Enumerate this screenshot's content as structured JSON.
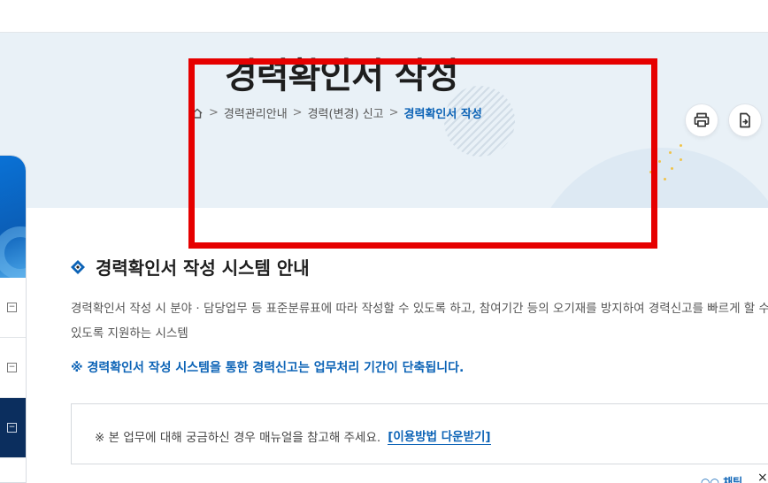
{
  "hero": {
    "title": "경력확인서 작성"
  },
  "breadcrumb": {
    "home_icon": "home-icon",
    "items": [
      "경력관리안내",
      "경력(변경) 신고",
      "경력확인서 작성"
    ],
    "separator": ">"
  },
  "tools": {
    "print_icon": "print-icon",
    "share_icon": "document-export-icon"
  },
  "section": {
    "title": "경력확인서 작성 시스템 안내",
    "desc_line1": "경력확인서 작성 시 분야 · 담당업무 등 표준분류표에 따라 작성할 수 있도록 하고, 참여기간 등의 오기재를 방지하여 경력신고를 빠르게 할 수",
    "desc_line2": "있도록 지원하는 시스템",
    "notice": "※ 경력확인서 작성 시스템을 통한 경력신고는 업무처리 기간이 단축됩니다."
  },
  "info_box": {
    "text": "※ 본 업무에 대해 궁금하신 경우 매뉴얼을 참고해 주세요.",
    "link": "[이용방법 다운받기]"
  },
  "side_menu": {
    "toggle_symbols": [
      "−",
      "−",
      "−"
    ]
  },
  "corner": {
    "partial_text": "○○ 채팅",
    "close": "×"
  },
  "colors": {
    "accent_blue": "#0c63b6",
    "highlight_red": "#e60000",
    "hero_bg": "#e9f1f7",
    "side_active": "#0b2e5e"
  }
}
